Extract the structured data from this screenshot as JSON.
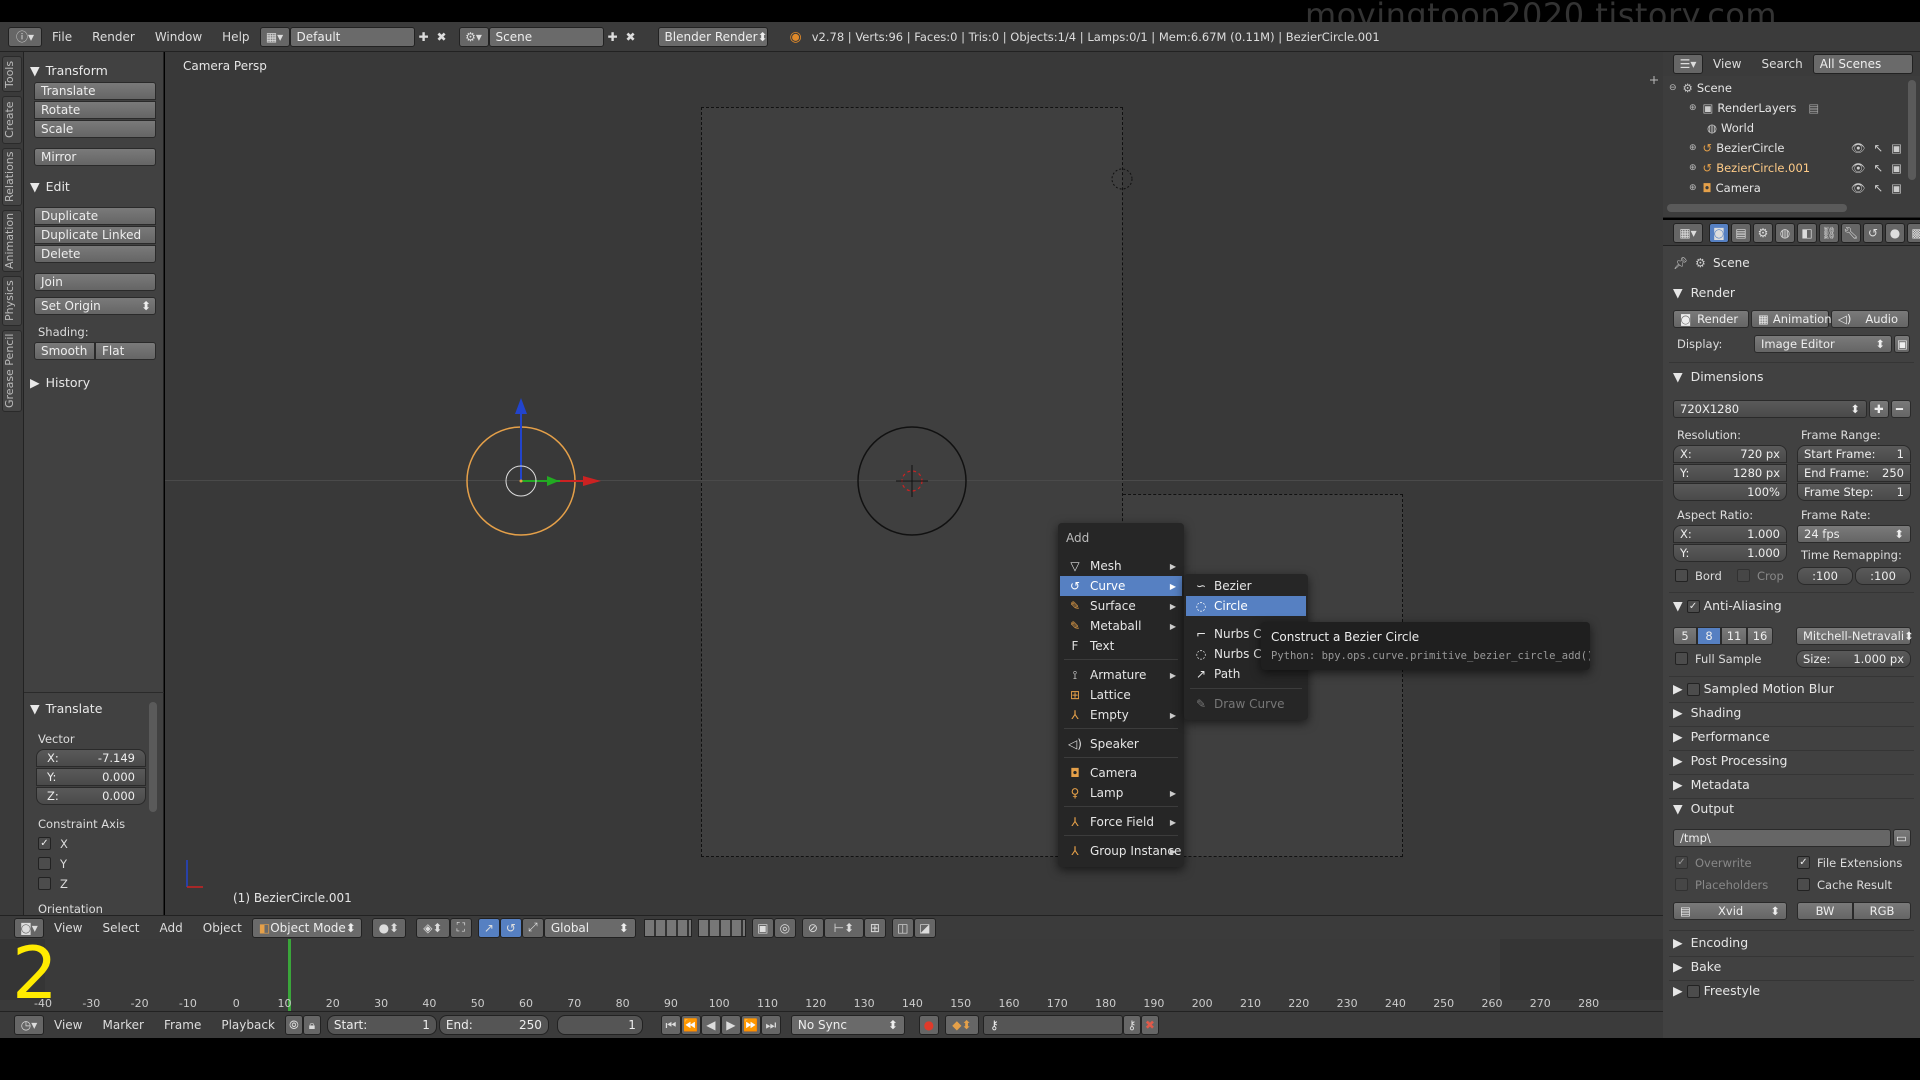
{
  "watermark": "movingtoon2020.tistory.com",
  "infobar": {
    "menus": [
      "File",
      "Render",
      "Window",
      "Help"
    ],
    "layout": "Default",
    "scene": "Scene",
    "engine": "Blender Render",
    "stats": "v2.78 | Verts:96 | Faces:0 | Tris:0 | Objects:1/4 | Lamps:0/1 | Mem:6.67M (0.11M) | BezierCircle.001"
  },
  "tabs": [
    "Tools",
    "Create",
    "Relations",
    "Animation",
    "Physics",
    "Grease Pencil"
  ],
  "toolshelf": {
    "transform_title": "Transform",
    "translate": "Translate",
    "rotate": "Rotate",
    "scale": "Scale",
    "mirror": "Mirror",
    "edit_title": "Edit",
    "duplicate": "Duplicate",
    "duplicate_linked": "Duplicate Linked",
    "delete": "Delete",
    "join": "Join",
    "set_origin": "Set Origin",
    "shading_label": "Shading:",
    "smooth": "Smooth",
    "flat": "Flat",
    "history_title": "History"
  },
  "operator": {
    "title": "Translate",
    "vector_label": "Vector",
    "x_label": "X:",
    "x_value": "-7.149",
    "y_label": "Y:",
    "y_value": "0.000",
    "z_label": "Z:",
    "z_value": "0.000",
    "constraint_label": "Constraint Axis",
    "cx": "X",
    "cy": "Y",
    "cz": "Z",
    "orientation_label": "Orientation"
  },
  "viewport": {
    "label": "Camera Persp",
    "object_label": "(1) BezierCircle.001"
  },
  "viewport_header": {
    "view": "View",
    "select": "Select",
    "add": "Add",
    "object": "Object",
    "mode": "Object Mode",
    "orientation": "Global"
  },
  "add_menu": {
    "title": "Add",
    "items": [
      {
        "label": "Mesh"
      },
      {
        "label": "Curve"
      },
      {
        "label": "Surface"
      },
      {
        "label": "Metaball"
      },
      {
        "label": "Text"
      },
      {
        "label": "Armature"
      },
      {
        "label": "Lattice"
      },
      {
        "label": "Empty"
      },
      {
        "label": "Speaker"
      },
      {
        "label": "Camera"
      },
      {
        "label": "Lamp"
      },
      {
        "label": "Force Field"
      },
      {
        "label": "Group Instance"
      }
    ]
  },
  "curve_submenu": {
    "items": [
      {
        "label": "Bezier"
      },
      {
        "label": "Circle"
      },
      {
        "label": "Nurbs Curve"
      },
      {
        "label": "Nurbs Circle"
      },
      {
        "label": "Path"
      },
      {
        "label": "Draw Curve"
      }
    ]
  },
  "tooltip": {
    "title": "Construct a Bezier Circle",
    "python": "Python: bpy.ops.curve.primitive_bezier_circle_add()"
  },
  "timeline": {
    "frame_overlay": "2",
    "ticks": [
      "-40",
      "-30",
      "-20",
      "-10",
      "0",
      "10",
      "20",
      "30",
      "40",
      "50",
      "60",
      "70",
      "80",
      "90",
      "100",
      "110",
      "120",
      "130",
      "140",
      "150",
      "160",
      "170",
      "180",
      "190",
      "200",
      "210",
      "220",
      "230",
      "240",
      "250",
      "260",
      "270",
      "280"
    ],
    "view": "View",
    "marker": "Marker",
    "frame": "Frame",
    "playback": "Playback",
    "start_label": "Start:",
    "start_value": "1",
    "end_label": "End:",
    "end_value": "250",
    "current": "1",
    "sync": "No Sync"
  },
  "outliner": {
    "view": "View",
    "search": "Search",
    "filter": "All Scenes",
    "rows": [
      {
        "label": "Scene"
      },
      {
        "label": "RenderLayers"
      },
      {
        "label": "World"
      },
      {
        "label": "BezierCircle"
      },
      {
        "label": "BezierCircle.001"
      },
      {
        "label": "Camera"
      }
    ]
  },
  "properties": {
    "scene": "Scene",
    "render_title": "Render",
    "render_btn": "Render",
    "animation_btn": "Animation",
    "audio_btn": "Audio",
    "display_label": "Display:",
    "display_value": "Image Editor",
    "dimensions_title": "Dimensions",
    "preset": "720X1280",
    "resolution_label": "Resolution:",
    "res_x_label": "X:",
    "res_x": "720 px",
    "res_y_label": "Y:",
    "res_y": "1280 px",
    "res_pct": "100%",
    "frame_range_label": "Frame Range:",
    "start_frame_label": "Start Frame:",
    "start_frame": "1",
    "end_frame_label": "End Frame:",
    "end_frame": "250",
    "frame_step_label": "Frame Step:",
    "frame_step": "1",
    "aspect_label": "Aspect Ratio:",
    "asp_x_label": "X:",
    "asp_x": "1.000",
    "asp_y_label": "Y:",
    "asp_y": "1.000",
    "frame_rate_label": "Frame Rate:",
    "frame_rate": "24 fps",
    "bord": "Bord",
    "crop": "Crop",
    "time_remap_label": "Time Remapping:",
    "remap_old": ":100",
    "remap_new": ":100",
    "aa_title": "Anti-Aliasing",
    "aa_5": "5",
    "aa_8": "8",
    "aa_11": "11",
    "aa_16": "16",
    "aa_filter": "Mitchell-Netravali",
    "full_sample": "Full Sample",
    "size_label": "Size:",
    "size_value": "1.000 px",
    "sampled_motion_blur": "Sampled Motion Blur",
    "shading": "Shading",
    "performance": "Performance",
    "post_processing": "Post Processing",
    "metadata": "Metadata",
    "output_title": "Output",
    "output_path": "/tmp\\",
    "overwrite": "Overwrite",
    "file_extensions": "File Extensions",
    "placeholders": "Placeholders",
    "cache_result": "Cache Result",
    "codec": "Xvid",
    "bw": "BW",
    "rgb": "RGB",
    "encoding": "Encoding",
    "bake": "Bake",
    "freestyle": "Freestyle"
  },
  "colors": {
    "accent": "#5680c2",
    "bezier_selected": "#e5a049",
    "axis_x": "#cc2222",
    "axis_y": "#22aa22",
    "axis_z": "#2244cc"
  }
}
